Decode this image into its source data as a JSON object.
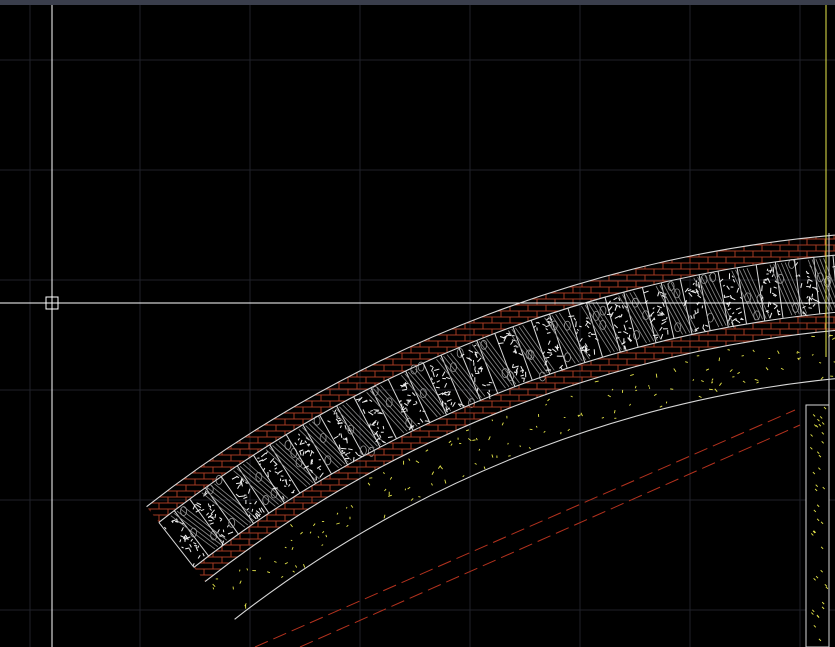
{
  "app": {
    "view": "model-space",
    "background": "#000000",
    "topbar_color": "#3a3e4c"
  },
  "colors": {
    "grid": "#1f2129",
    "outline": "#d8d8d8",
    "brick": "#a33a22",
    "filling": "#f2f2f2",
    "yellow": "#e8e84a",
    "dashed_red": "#b4321e",
    "crosshair": "#ffffff"
  },
  "cursor": {
    "type": "crosshair",
    "icon": "pickbox-icon"
  },
  "layers": [
    "arch-outline",
    "brick-hatch",
    "concrete-fill",
    "insulation-fill",
    "dashed-line"
  ]
}
